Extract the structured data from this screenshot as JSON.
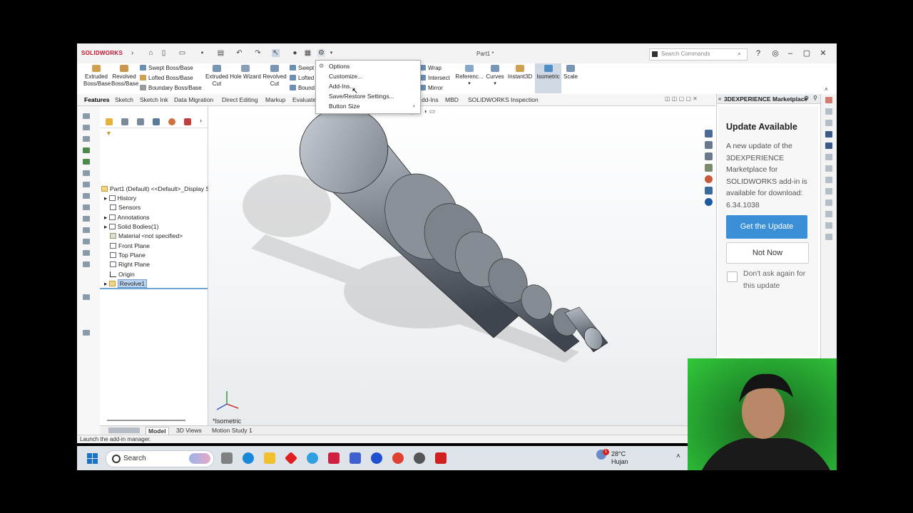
{
  "app": {
    "logo": "SOLIDWORKS",
    "doc_title": "Part1 *",
    "search_placeholder": "Search Commands"
  },
  "ribbon": {
    "extruded_boss": "Extruded\nBoss/Base",
    "revolved_boss": "Revolved\nBoss/Base",
    "swept_boss": "Swept Boss/Base",
    "lofted_boss": "Lofted Boss/Base",
    "boundary_boss": "Boundary Boss/Base",
    "extruded_cut": "Extruded\nCut",
    "hole_wizard": "Hole Wizard",
    "revolved_cut": "Revolved\nCut",
    "swept": "Swept",
    "lofted": "Lofted",
    "bound": "Bound",
    "wrap": "Wrap",
    "intersect": "Intersect",
    "mirror": "Mirror",
    "reference": "Referenc...",
    "curves": "Curves",
    "instant3d": "Instant3D",
    "isometric": "Isometric",
    "scale": "Scale"
  },
  "tabs": [
    "Features",
    "Sketch",
    "Sketch Ink",
    "Data Migration",
    "Direct Editing",
    "Markup",
    "Evaluate",
    "dd-Ins",
    "MBD",
    "SOLIDWORKS Inspection"
  ],
  "dropdown": [
    "Options",
    "Customize...",
    "Add-Ins...",
    "Save/Restore Settings...",
    "Button Size"
  ],
  "tree": {
    "root": "Part1 (Default) <<Default>_Display S",
    "items": [
      "History",
      "Sensors",
      "Annotations",
      "Solid Bodies(1)",
      "Material <not specified>",
      "Front Plane",
      "Top Plane",
      "Right Plane",
      "Origin",
      "Revolve1"
    ]
  },
  "viewport": {
    "view_label": "*Isometric"
  },
  "bottom_tabs": [
    "Model",
    "3D Views",
    "Motion Study 1"
  ],
  "status": "Launch the add-in manager.",
  "marketplace": {
    "header": "3DEXPERIENCE Marketplace",
    "title": "Update Available",
    "message": "A new update of the 3DEXPERIENCE Marketplace for SOLIDWORKS add-in is available for download: 6.34.1038",
    "primary_button": "Get the Update",
    "secondary_button": "Not Now",
    "checkbox_label": "Don't ask again for this update"
  },
  "taskbar": {
    "search": "Search",
    "temperature": "28°C",
    "weather": "Hujan",
    "notif_badge": "1"
  },
  "colors": {
    "accent": "#3a8fd6",
    "brand": "#c8102e",
    "selection": "#bcd4f0"
  }
}
